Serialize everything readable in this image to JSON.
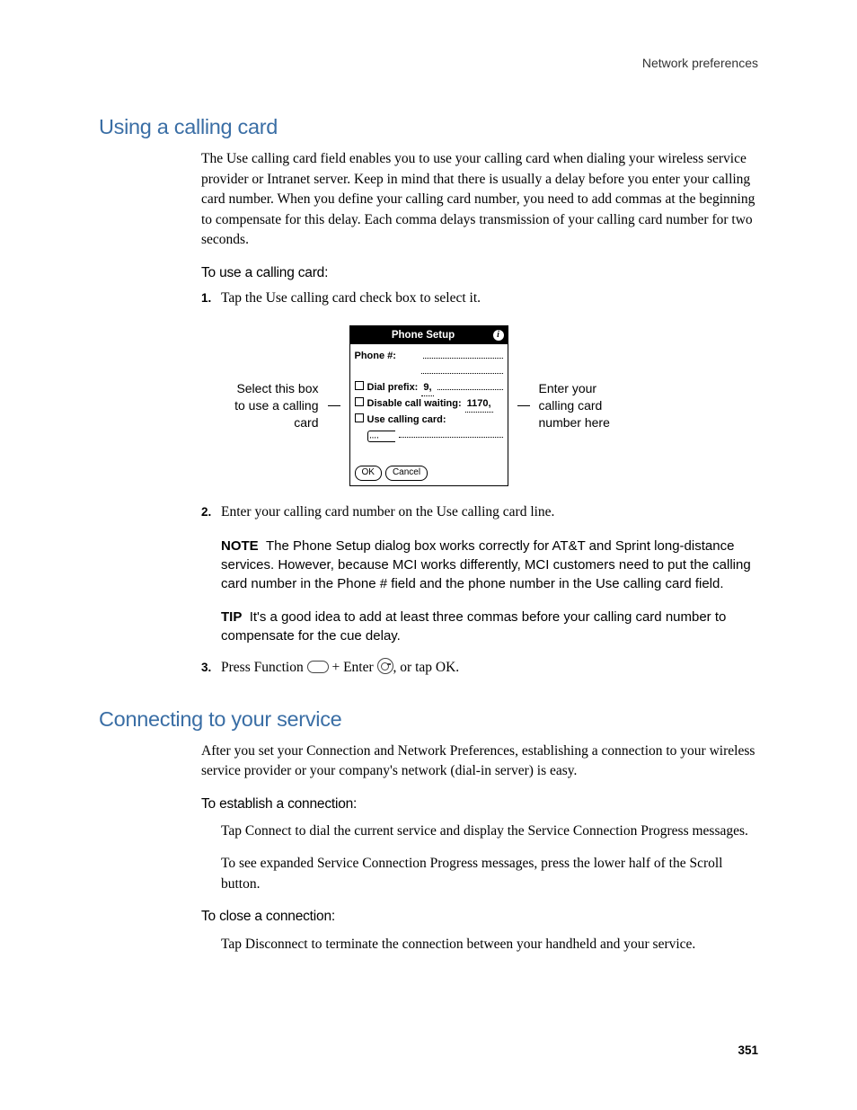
{
  "runningHead": "Network preferences",
  "pageNumber": "351",
  "section1": {
    "title": "Using a calling card",
    "intro": "The Use calling card field enables you to use your calling card when dialing your wireless service provider or Intranet server. Keep in mind that there is usually a delay before you enter your calling card number. When you define your calling card number, you need to add commas at the beginning to compensate for this delay. Each comma delays transmission of your calling card number for two seconds.",
    "procTitle": "To use a calling card:",
    "step1": "Tap the Use calling card check box to select it.",
    "step2": "Enter your calling card number on the Use calling card line.",
    "noteLabel": "NOTE",
    "noteText": "The Phone Setup dialog box works correctly for AT&T and Sprint long-distance services. However, because MCI works differently, MCI customers need to put the calling card number in the Phone # field and the phone number in the Use calling card field.",
    "tipLabel": "TIP",
    "tipText": "It's a good idea to add at least three commas before your calling card number to compensate for the cue delay.",
    "step3a": "Press Function ",
    "step3b": " + Enter ",
    "step3c": ", or tap OK."
  },
  "figure": {
    "leftLabel": "Select this box to use a calling card",
    "rightLabel": "Enter your calling card number here",
    "dlgTitle": "Phone Setup",
    "phoneLbl": "Phone #:",
    "dialPrefixLbl": "Dial prefix:",
    "dialPrefixVal": "9,",
    "disableCWLbl": "Disable call waiting:",
    "disableCWVal": "1170,",
    "useCCLbl": "Use calling card:",
    "commas": ",,,,",
    "okBtn": "OK",
    "cancelBtn": "Cancel"
  },
  "section2": {
    "title": "Connecting to your service",
    "intro": "After you set your Connection and Network Preferences, establishing a connection to your wireless service provider or your company's network (dial-in server) is easy.",
    "procEstablish": "To establish a connection:",
    "establish1": "Tap Connect to dial the current service and display the Service Connection Progress messages.",
    "establish2": "To see expanded Service Connection Progress messages, press the lower half of the Scroll button.",
    "procClose": "To close a connection:",
    "close1": "Tap Disconnect to terminate the connection between your handheld and your service."
  }
}
